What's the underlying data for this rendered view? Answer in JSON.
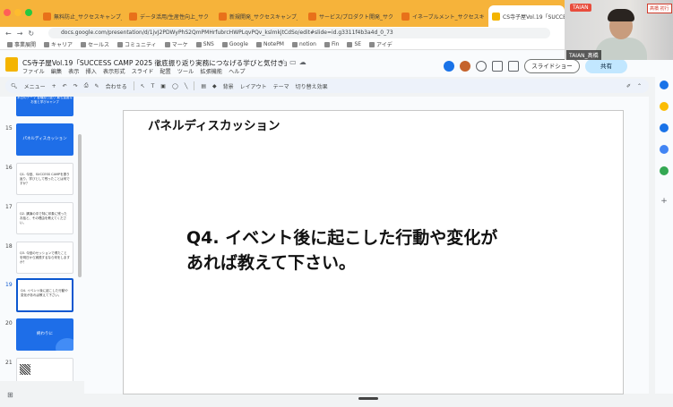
{
  "browser": {
    "tabs": [
      {
        "label": "無料防止_サクセスキャンプ_主"
      },
      {
        "label": "データ活用/生産性向上_サクセ"
      },
      {
        "label": "新規開発_サクセスキャンプ_主"
      },
      {
        "label": "サービス/プロダクト開発_サク"
      },
      {
        "label": "イネーブルメント_サクセスキャ"
      },
      {
        "label": "CS寺子屋Vol.19「SUCCESS C"
      }
    ],
    "url": "docs.google.com/presentation/d/1jvJ2PDWyPhS2QmPMHrfubrcHWPLqvPQv_kslmkjtCdSo/edit#slide=id.g3311f4b3a4d_0_73",
    "bookmarks": [
      "事業展開",
      "キャリア",
      "セールス",
      "コミュニティ",
      "マーケ",
      "SNS",
      "Google",
      "NotePM",
      "notion",
      "Fin",
      "SE",
      "アイデ"
    ]
  },
  "docs": {
    "title": "CS寺子屋Vol.19「SUCCESS CAMP 2025 徹底振り返り実務につなげる学びと気付き」",
    "menu": [
      "ファイル",
      "編集",
      "表示",
      "挿入",
      "表示形式",
      "スライド",
      "配置",
      "ツール",
      "拡張機能",
      "ヘルプ"
    ],
    "slideshow_label": "スライドショー",
    "share_label": "共有"
  },
  "toolbar": {
    "menu_label": "メニュー",
    "zoom_label": "合わせる",
    "background_label": "背景",
    "layout_label": "レイアウト",
    "theme_label": "テーマ",
    "transition_label": "切り替え効果"
  },
  "filmstrip": {
    "slides": [
      {
        "num": "14",
        "text": "本日のテーマ 各種振り返り 最も重要なお宝と学びキャンプ",
        "style": "blue"
      },
      {
        "num": "15",
        "text": "パネルディスカッション",
        "style": "blue"
      },
      {
        "num": "16",
        "text": "Q1. 今回、SUCCESS CAMPを振り返り、学びとして残ったことは何ですか？",
        "style": "white"
      },
      {
        "num": "17",
        "text": "Q2. 講演の中で特に印象に残ったお話と、その理由を教えてください。",
        "style": "white"
      },
      {
        "num": "18",
        "text": "Q3. 今回のセッションで得たことを明日から実践するなら何をしますか？",
        "style": "white"
      },
      {
        "num": "19",
        "text": "Q4. イベント後に起こした行動や変化があれば教えて下さい。",
        "style": "white"
      },
      {
        "num": "20",
        "text": "終わりに",
        "style": "blue"
      },
      {
        "num": "21",
        "text": "",
        "style": "white"
      }
    ]
  },
  "slide": {
    "title": "パネルディスカッション",
    "body_line1": "Q4. イベント後に起こした行動や変化が",
    "body_line2": "あれば教えて下さい。"
  },
  "video": {
    "logo": "TAIAN",
    "sign": "髙橋 初行",
    "name": "TAIAN_髙橋"
  },
  "colors": {
    "tabstrip": "#f6b33a",
    "accent_blue": "#0b57d0",
    "thumb_blue": "#1e6ee8"
  }
}
